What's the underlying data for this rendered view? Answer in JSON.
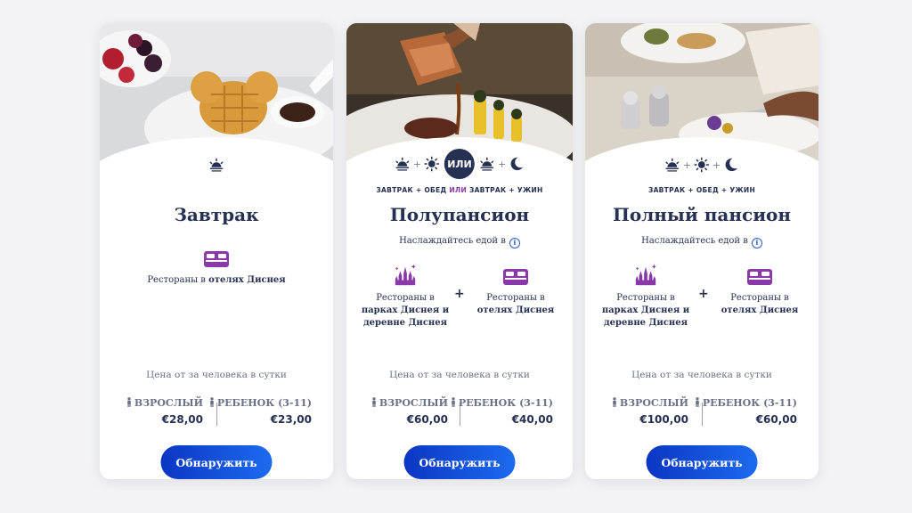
{
  "colors": {
    "navy": "#253053",
    "accent_purple": "#8a3aa8",
    "cta_blue": "#0b36c4",
    "muted": "#6b7186"
  },
  "cards": [
    {
      "title": "Завтрак",
      "venues": [
        {
          "icon": "hotel-bed-icon",
          "line1": "Рестораны в",
          "bold": "отелях Диснея"
        }
      ],
      "price_label": "Цена от за человека в сутки",
      "adult_label": "ВЗРОСЛЫЙ",
      "child_label": "РЕБЕНОК (3-11)",
      "adult_price": "€28,00",
      "child_price": "€23,00",
      "cta": "Обнаружить"
    },
    {
      "title": "Полупансион",
      "or_badge": "ИЛИ",
      "meal_caption_a": "ЗАВТРАК + ОБЕД",
      "meal_caption_or": "ИЛИ",
      "meal_caption_b": "ЗАВТРАК + УЖИН",
      "enjoy": "Наслаждайтесь едой в",
      "venues": [
        {
          "icon": "castle-icon",
          "line1": "Рестораны в",
          "bold": "парках Диснея и деревне Диснея"
        },
        {
          "icon": "hotel-bed-icon",
          "line1": "Рестораны в",
          "bold": "отелях Диснея"
        }
      ],
      "price_label": "Цена от за человека в сутки",
      "adult_label": "ВЗРОСЛЫЙ",
      "child_label": "РЕБЕНОК (3-11)",
      "adult_price": "€60,00",
      "child_price": "€40,00",
      "cta": "Обнаружить"
    },
    {
      "title": "Полный пансион",
      "meal_caption": "ЗАВТРАК + ОБЕД + УЖИН",
      "enjoy": "Наслаждайтесь едой в",
      "venues": [
        {
          "icon": "castle-icon",
          "line1": "Рестораны в",
          "bold": "парках Диснея и деревне Диснея"
        },
        {
          "icon": "hotel-bed-icon",
          "line1": "Рестораны в",
          "bold": "отелях Диснея"
        }
      ],
      "price_label": "Цена от за человека в сутки",
      "adult_label": "ВЗРОСЛЫЙ",
      "child_label": "РЕБЕНОК (3-11)",
      "adult_price": "€100,00",
      "child_price": "€60,00",
      "cta": "Обнаружить"
    }
  ],
  "venue_plus": "+",
  "meal_plus": "+"
}
